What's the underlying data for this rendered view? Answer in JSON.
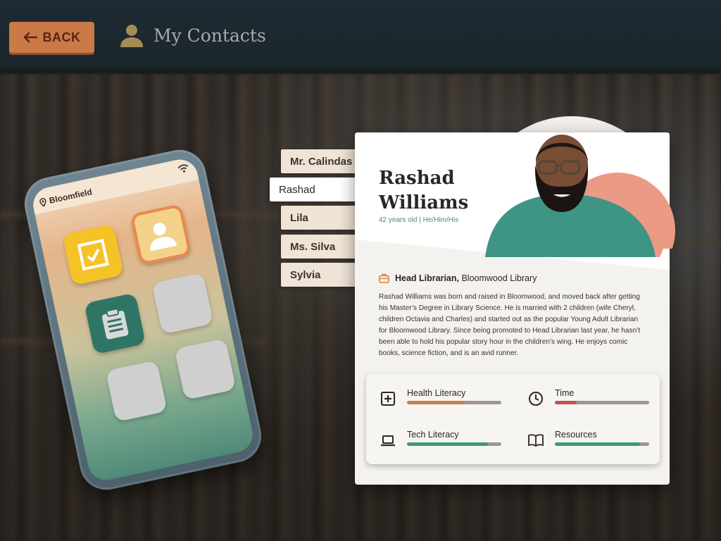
{
  "header": {
    "back_label": "BACK",
    "title": "My Contacts"
  },
  "phone": {
    "location": "Bloomfield"
  },
  "contacts": [
    {
      "label": "Mr. Calindas",
      "active": false
    },
    {
      "label": "Rashad",
      "active": true
    },
    {
      "label": "Lila",
      "active": false
    },
    {
      "label": "Ms. Silva",
      "active": false
    },
    {
      "label": "Sylvia",
      "active": false
    }
  ],
  "profile": {
    "first_name": "Rashad",
    "last_name": "Williams",
    "meta": "42 years old | He/Him/His",
    "role_title": "Head Librarian,",
    "role_org": " Bloomwood Library",
    "bio": "Rashad Williams was born and raised in Bloomwood, and moved back after getting his Master’s Degree in Library Science. He is married with 2 children (wife Cheryl, children Octavia and Charles) and started out as the popular Young Adult Librarian for Bloomwood Library. Since being promoted to Head Librarian last year, he hasn’t been able to hold his popular story hour in the children’s wing. He enjoys comic books, science fiction, and is an avid runner."
  },
  "stats": [
    {
      "label": "Health Literacy",
      "fraction": 0.62,
      "color": "#c9824e",
      "icon": "medical-kit-icon"
    },
    {
      "label": "Time",
      "fraction": 0.23,
      "color": "#c9514f",
      "icon": "clock-icon"
    },
    {
      "label": "Tech Literacy",
      "fraction": 0.86,
      "color": "#3f9a74",
      "icon": "laptop-icon"
    },
    {
      "label": "Resources",
      "fraction": 0.9,
      "color": "#3f9a74",
      "icon": "book-icon"
    }
  ],
  "colors": {
    "accent_button": "#c97a47",
    "teal_text": "#3d8f80",
    "topbar": "#1f2b33"
  }
}
